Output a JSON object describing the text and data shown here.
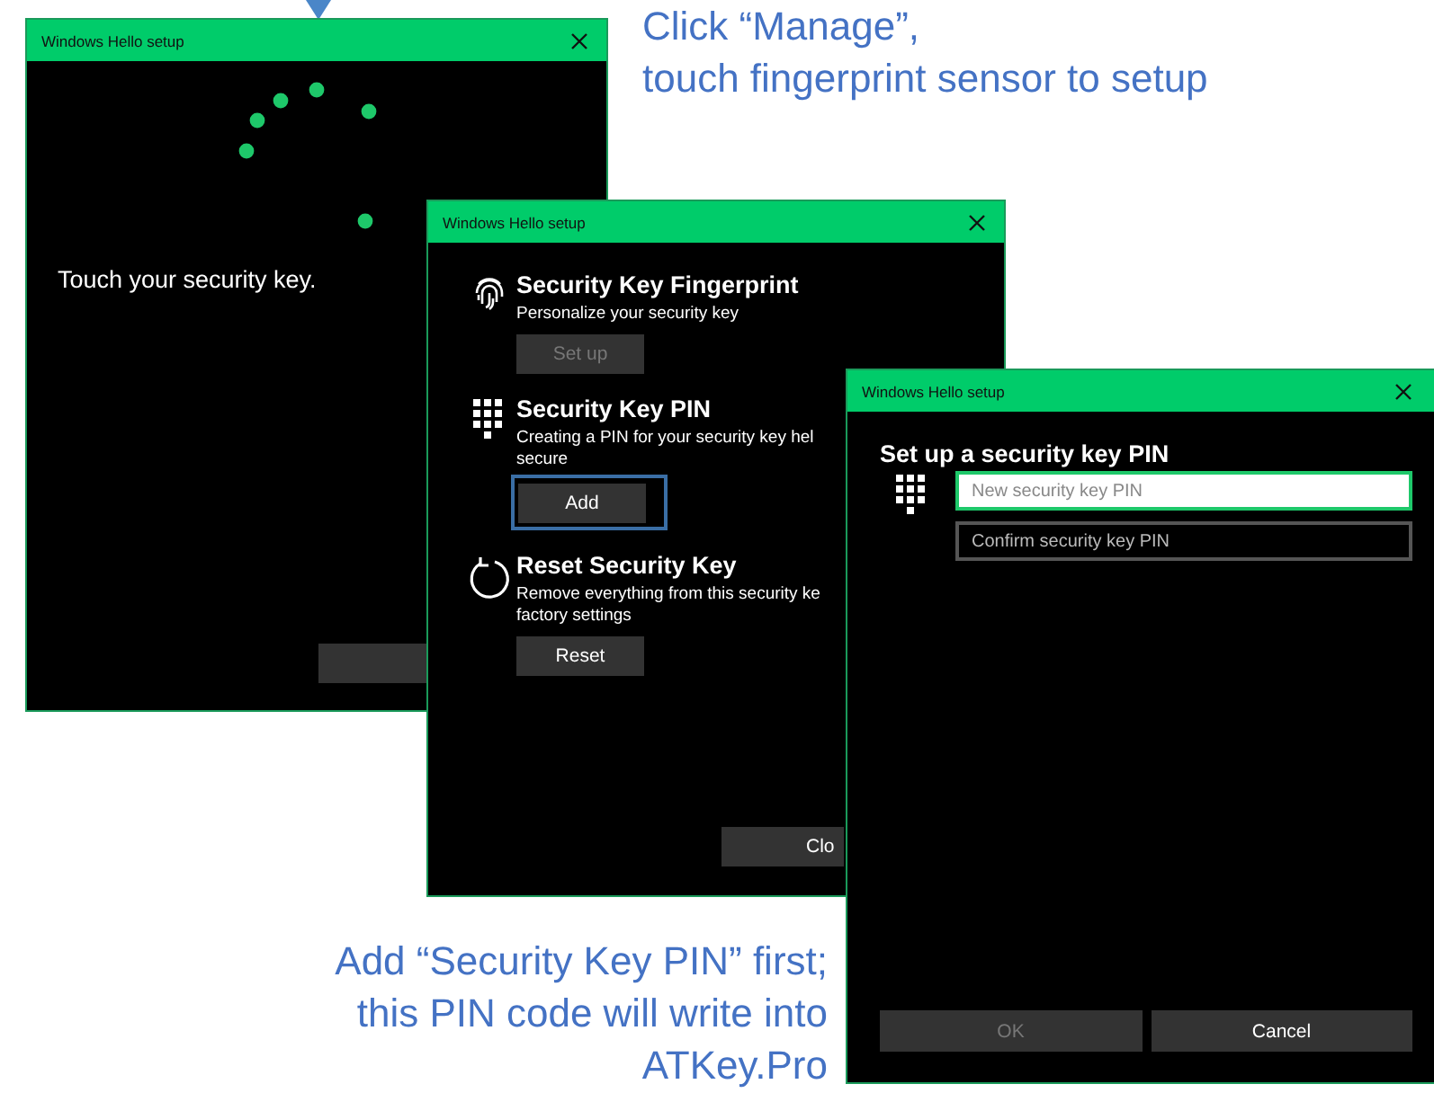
{
  "top_note": {
    "lines": [
      "Click “Manage”,",
      "touch fingerprint sensor to setup"
    ]
  },
  "windows": [
    {
      "kind": "progress",
      "title": "Windows Hello setup",
      "message": "Touch your security key."
    },
    {
      "kind": "manage",
      "title": "Windows Hello setup",
      "sections": [
        {
          "kind": "fingerprint",
          "heading": "Security Key Fingerprint",
          "description": "Personalize your security key",
          "button": {
            "label": "Set up",
            "disabled": true,
            "focused": false
          }
        },
        {
          "kind": "keypad",
          "heading": "Security Key PIN",
          "description": "Creating a PIN for your security key hel\nsecure",
          "button": {
            "label": "Add",
            "disabled": false,
            "focused": true
          }
        },
        {
          "kind": "reset",
          "heading": "Reset Security Key",
          "description": "Remove everything from this security ke\nfactory settings",
          "button": {
            "label": "Reset",
            "disabled": false,
            "focused": false
          }
        }
      ],
      "close_button": {
        "label": "Clo"
      }
    },
    {
      "kind": "pin",
      "title": "Windows Hello setup",
      "heading": "Set up a security key PIN",
      "fields": [
        {
          "placeholder": "New security key PIN",
          "focused": true
        },
        {
          "placeholder": "Confirm security key PIN",
          "focused": false
        }
      ],
      "buttons": [
        {
          "label": "OK",
          "disabled": true
        },
        {
          "label": "Cancel",
          "disabled": false
        }
      ]
    }
  ],
  "bottom_note": {
    "lines": [
      "Add “Security Key PIN” first;",
      "this PIN code will write into",
      "ATKey.Pro"
    ]
  }
}
